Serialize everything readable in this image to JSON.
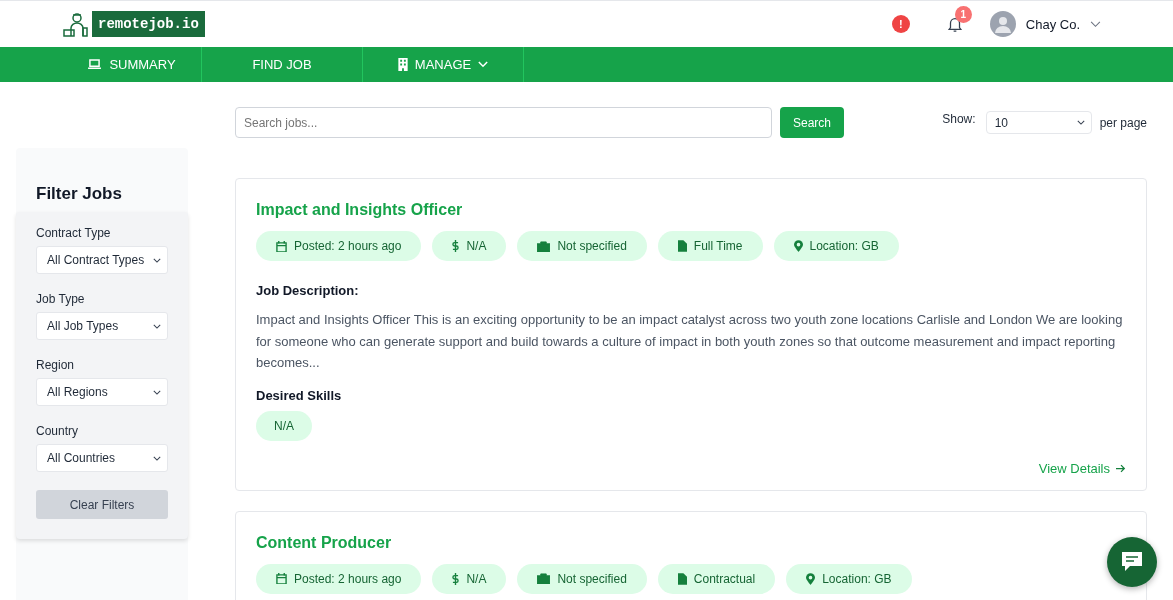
{
  "logo": {
    "text": "remotejob.io"
  },
  "header": {
    "alert_badge": "!",
    "notification_count": "1",
    "user": "Chay Co."
  },
  "nav": [
    {
      "label": "SUMMARY",
      "kind": "laptop"
    },
    {
      "label": "FIND JOB",
      "kind": "none"
    },
    {
      "label": "MANAGE",
      "kind": "building",
      "dropdown": true
    }
  ],
  "search": {
    "placeholder": "Search jobs...",
    "button": "Search",
    "show_label": "Show:",
    "per_page": "10",
    "per_page_suffix": "per page"
  },
  "filters": {
    "title": "Filter Jobs",
    "fields": [
      {
        "label": "Contract Type",
        "value": "All Contract Types"
      },
      {
        "label": "Job Type",
        "value": "All Job Types"
      },
      {
        "label": "Region",
        "value": "All Regions"
      },
      {
        "label": "Country",
        "value": "All Countries"
      }
    ],
    "clear": "Clear Filters"
  },
  "jobs": [
    {
      "title": "Impact and Insights Officer",
      "tags": [
        {
          "kind": "calendar",
          "text": "Posted: 2 hours ago"
        },
        {
          "kind": "dollar",
          "text": "N/A"
        },
        {
          "kind": "briefcase",
          "text": "Not specified"
        },
        {
          "kind": "file",
          "text": "Full Time"
        },
        {
          "kind": "location",
          "text": "Location: GB"
        }
      ],
      "description_label": "Job Description:",
      "description": "Impact and Insights Officer This is an exciting opportunity to be an impact catalyst across two youth zone locations Carlisle and London We are looking for someone who can generate support and build towards a culture of impact in both youth zones so that outcome measurement and impact reporting becomes...",
      "skills_label": "Desired Skills",
      "skills": [
        "N/A"
      ],
      "link": "View Details"
    },
    {
      "title": "Content Producer",
      "tags": [
        {
          "kind": "calendar",
          "text": "Posted: 2 hours ago"
        },
        {
          "kind": "dollar",
          "text": "N/A"
        },
        {
          "kind": "briefcase",
          "text": "Not specified"
        },
        {
          "kind": "file",
          "text": "Contractual"
        },
        {
          "kind": "location",
          "text": "Location: GB"
        }
      ]
    }
  ]
}
